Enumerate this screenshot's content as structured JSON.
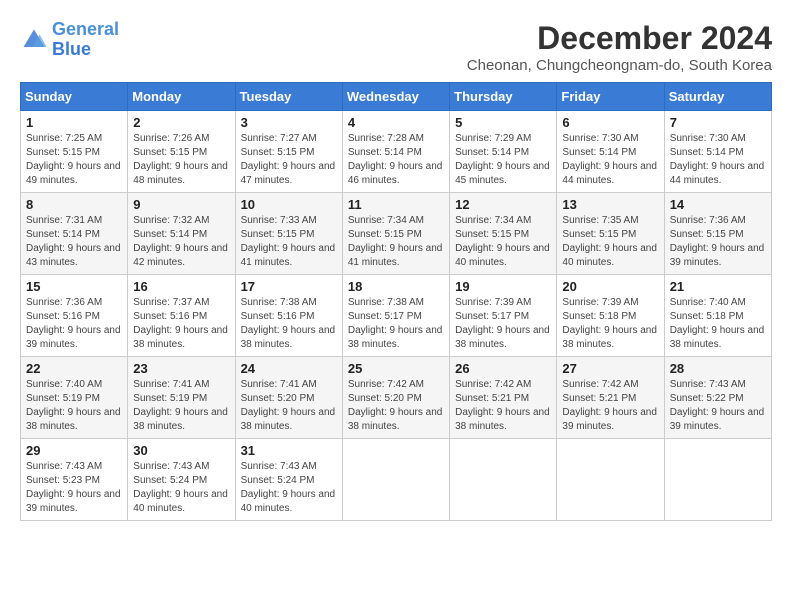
{
  "header": {
    "logo_line1": "General",
    "logo_line2": "Blue",
    "month_title": "December 2024",
    "subtitle": "Cheonan, Chungcheongnam-do, South Korea"
  },
  "weekdays": [
    "Sunday",
    "Monday",
    "Tuesday",
    "Wednesday",
    "Thursday",
    "Friday",
    "Saturday"
  ],
  "weeks": [
    [
      {
        "day": "1",
        "sunrise": "Sunrise: 7:25 AM",
        "sunset": "Sunset: 5:15 PM",
        "daylight": "Daylight: 9 hours and 49 minutes."
      },
      {
        "day": "2",
        "sunrise": "Sunrise: 7:26 AM",
        "sunset": "Sunset: 5:15 PM",
        "daylight": "Daylight: 9 hours and 48 minutes."
      },
      {
        "day": "3",
        "sunrise": "Sunrise: 7:27 AM",
        "sunset": "Sunset: 5:15 PM",
        "daylight": "Daylight: 9 hours and 47 minutes."
      },
      {
        "day": "4",
        "sunrise": "Sunrise: 7:28 AM",
        "sunset": "Sunset: 5:14 PM",
        "daylight": "Daylight: 9 hours and 46 minutes."
      },
      {
        "day": "5",
        "sunrise": "Sunrise: 7:29 AM",
        "sunset": "Sunset: 5:14 PM",
        "daylight": "Daylight: 9 hours and 45 minutes."
      },
      {
        "day": "6",
        "sunrise": "Sunrise: 7:30 AM",
        "sunset": "Sunset: 5:14 PM",
        "daylight": "Daylight: 9 hours and 44 minutes."
      },
      {
        "day": "7",
        "sunrise": "Sunrise: 7:30 AM",
        "sunset": "Sunset: 5:14 PM",
        "daylight": "Daylight: 9 hours and 44 minutes."
      }
    ],
    [
      {
        "day": "8",
        "sunrise": "Sunrise: 7:31 AM",
        "sunset": "Sunset: 5:14 PM",
        "daylight": "Daylight: 9 hours and 43 minutes."
      },
      {
        "day": "9",
        "sunrise": "Sunrise: 7:32 AM",
        "sunset": "Sunset: 5:14 PM",
        "daylight": "Daylight: 9 hours and 42 minutes."
      },
      {
        "day": "10",
        "sunrise": "Sunrise: 7:33 AM",
        "sunset": "Sunset: 5:15 PM",
        "daylight": "Daylight: 9 hours and 41 minutes."
      },
      {
        "day": "11",
        "sunrise": "Sunrise: 7:34 AM",
        "sunset": "Sunset: 5:15 PM",
        "daylight": "Daylight: 9 hours and 41 minutes."
      },
      {
        "day": "12",
        "sunrise": "Sunrise: 7:34 AM",
        "sunset": "Sunset: 5:15 PM",
        "daylight": "Daylight: 9 hours and 40 minutes."
      },
      {
        "day": "13",
        "sunrise": "Sunrise: 7:35 AM",
        "sunset": "Sunset: 5:15 PM",
        "daylight": "Daylight: 9 hours and 40 minutes."
      },
      {
        "day": "14",
        "sunrise": "Sunrise: 7:36 AM",
        "sunset": "Sunset: 5:15 PM",
        "daylight": "Daylight: 9 hours and 39 minutes."
      }
    ],
    [
      {
        "day": "15",
        "sunrise": "Sunrise: 7:36 AM",
        "sunset": "Sunset: 5:16 PM",
        "daylight": "Daylight: 9 hours and 39 minutes."
      },
      {
        "day": "16",
        "sunrise": "Sunrise: 7:37 AM",
        "sunset": "Sunset: 5:16 PM",
        "daylight": "Daylight: 9 hours and 38 minutes."
      },
      {
        "day": "17",
        "sunrise": "Sunrise: 7:38 AM",
        "sunset": "Sunset: 5:16 PM",
        "daylight": "Daylight: 9 hours and 38 minutes."
      },
      {
        "day": "18",
        "sunrise": "Sunrise: 7:38 AM",
        "sunset": "Sunset: 5:17 PM",
        "daylight": "Daylight: 9 hours and 38 minutes."
      },
      {
        "day": "19",
        "sunrise": "Sunrise: 7:39 AM",
        "sunset": "Sunset: 5:17 PM",
        "daylight": "Daylight: 9 hours and 38 minutes."
      },
      {
        "day": "20",
        "sunrise": "Sunrise: 7:39 AM",
        "sunset": "Sunset: 5:18 PM",
        "daylight": "Daylight: 9 hours and 38 minutes."
      },
      {
        "day": "21",
        "sunrise": "Sunrise: 7:40 AM",
        "sunset": "Sunset: 5:18 PM",
        "daylight": "Daylight: 9 hours and 38 minutes."
      }
    ],
    [
      {
        "day": "22",
        "sunrise": "Sunrise: 7:40 AM",
        "sunset": "Sunset: 5:19 PM",
        "daylight": "Daylight: 9 hours and 38 minutes."
      },
      {
        "day": "23",
        "sunrise": "Sunrise: 7:41 AM",
        "sunset": "Sunset: 5:19 PM",
        "daylight": "Daylight: 9 hours and 38 minutes."
      },
      {
        "day": "24",
        "sunrise": "Sunrise: 7:41 AM",
        "sunset": "Sunset: 5:20 PM",
        "daylight": "Daylight: 9 hours and 38 minutes."
      },
      {
        "day": "25",
        "sunrise": "Sunrise: 7:42 AM",
        "sunset": "Sunset: 5:20 PM",
        "daylight": "Daylight: 9 hours and 38 minutes."
      },
      {
        "day": "26",
        "sunrise": "Sunrise: 7:42 AM",
        "sunset": "Sunset: 5:21 PM",
        "daylight": "Daylight: 9 hours and 38 minutes."
      },
      {
        "day": "27",
        "sunrise": "Sunrise: 7:42 AM",
        "sunset": "Sunset: 5:21 PM",
        "daylight": "Daylight: 9 hours and 39 minutes."
      },
      {
        "day": "28",
        "sunrise": "Sunrise: 7:43 AM",
        "sunset": "Sunset: 5:22 PM",
        "daylight": "Daylight: 9 hours and 39 minutes."
      }
    ],
    [
      {
        "day": "29",
        "sunrise": "Sunrise: 7:43 AM",
        "sunset": "Sunset: 5:23 PM",
        "daylight": "Daylight: 9 hours and 39 minutes."
      },
      {
        "day": "30",
        "sunrise": "Sunrise: 7:43 AM",
        "sunset": "Sunset: 5:24 PM",
        "daylight": "Daylight: 9 hours and 40 minutes."
      },
      {
        "day": "31",
        "sunrise": "Sunrise: 7:43 AM",
        "sunset": "Sunset: 5:24 PM",
        "daylight": "Daylight: 9 hours and 40 minutes."
      },
      null,
      null,
      null,
      null
    ]
  ]
}
